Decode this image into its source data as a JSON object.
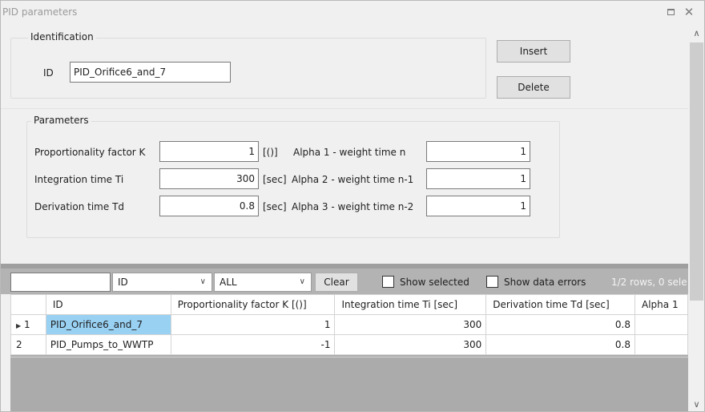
{
  "window": {
    "title": "PID parameters"
  },
  "identification": {
    "group_title": "Identification",
    "id_label": "ID",
    "id_value": "PID_Orifice6_and_7",
    "insert_label": "Insert",
    "delete_label": "Delete"
  },
  "parameters": {
    "group_title": "Parameters",
    "rows": [
      {
        "label": "Proportionality factor K",
        "value": "1",
        "unit": "[()]",
        "alpha_label": "Alpha 1 - weight time n",
        "alpha_value": "1"
      },
      {
        "label": "Integration time Ti",
        "value": "300",
        "unit": "[sec]",
        "alpha_label": "Alpha 2 - weight time n-1",
        "alpha_value": "1"
      },
      {
        "label": "Derivation time Td",
        "value": "0.8",
        "unit": "[sec]",
        "alpha_label": "Alpha 3 - weight time n-2",
        "alpha_value": "1"
      }
    ]
  },
  "filter_bar": {
    "search_value": "",
    "field_select": "ID",
    "scope_select": "ALL",
    "clear_label": "Clear",
    "show_selected_label": "Show selected",
    "show_errors_label": "Show data errors",
    "row_info": "1/2 rows, 0 sele"
  },
  "table": {
    "columns": [
      "ID",
      "Proportionality factor K [()]",
      "Integration time Ti [sec]",
      "Derivation time Td [sec]",
      "Alpha 1"
    ],
    "rows": [
      {
        "num": "1",
        "current": true,
        "id": "PID_Orifice6_and_7",
        "k": "1",
        "ti": "300",
        "td": "0.8",
        "a1": ""
      },
      {
        "num": "2",
        "current": false,
        "id": "PID_Pumps_to_WWTP",
        "k": "-1",
        "ti": "300",
        "td": "0.8",
        "a1": ""
      }
    ]
  },
  "icons": {
    "maximize": "maximize-icon",
    "close": "close-icon",
    "scroll_up": "chevron-up-icon",
    "scroll_down": "chevron-down-icon",
    "dropdown": "chevron-down-icon",
    "row_pointer": "row-pointer-icon"
  },
  "colors": {
    "selected_cell": "#99d1f3",
    "toolbar_bg": "#b3b3b3"
  }
}
